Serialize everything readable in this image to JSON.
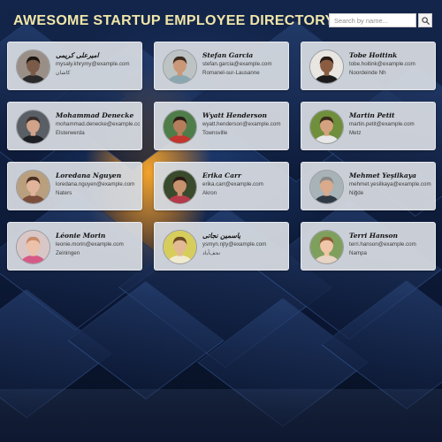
{
  "header": {
    "title": "AWESOME STARTUP EMPLOYEE DIRECTORY",
    "search": {
      "placeholder": "Search by name...",
      "value": ""
    },
    "search_button_icon": "search-icon"
  },
  "colors": {
    "title": "#f1e6a8",
    "card": "#d6dae0",
    "background": "#0e1d3c",
    "glow": "#ffa020"
  },
  "employees": [
    {
      "name": "امیرعلی کریمی",
      "email": "mysaly.khrymy@example.com",
      "city": "کاشان",
      "avatar": {
        "bg": "#9a8f86",
        "skin": "#7a5a48",
        "hair": "#1c1612",
        "shirt": "#2a2a2a"
      }
    },
    {
      "name": "Stefan Garcia",
      "email": "stefan.garcia@example.com",
      "city": "Romanel-sur-Lausanne",
      "avatar": {
        "bg": "#bcc3c2",
        "skin": "#c99878",
        "hair": "#3c2a1e",
        "shirt": "#8aa7b0"
      }
    },
    {
      "name": "Tobe Hoitink",
      "email": "tobe.hoitink@example.com",
      "city": "Noordeinde Nh",
      "avatar": {
        "bg": "#e9e6e2",
        "skin": "#8a5d42",
        "hair": "#2a1d16",
        "shirt": "#1b1b1b"
      }
    },
    {
      "name": "Mohammad Denecke",
      "email": "mohammad.denecke@example.com",
      "city": "Elsterwerda",
      "avatar": {
        "bg": "#5a5f66",
        "skin": "#d1a389",
        "hair": "#3a2f2a",
        "shirt": "#1d1f24"
      }
    },
    {
      "name": "Wyatt Henderson",
      "email": "wyatt.henderson@example.com",
      "city": "Townsville",
      "avatar": {
        "bg": "#4f7d4a",
        "skin": "#b57d5c",
        "hair": "#2b1e16",
        "shirt": "#c2362f"
      }
    },
    {
      "name": "Martin Petit",
      "email": "martin.petit@example.com",
      "city": "Metz",
      "avatar": {
        "bg": "#6f8f3c",
        "skin": "#d4a27e",
        "hair": "#3b2a1d",
        "shirt": "#e8e8e8"
      }
    },
    {
      "name": "Loredana Nguyen",
      "email": "loredana.nguyen@example.com",
      "city": "Naters",
      "avatar": {
        "bg": "#b99f7d",
        "skin": "#e0b49a",
        "hair": "#4a2f22",
        "shirt": "#7a4e3a"
      }
    },
    {
      "name": "Erika Carr",
      "email": "erika.carr@example.com",
      "city": "Akron",
      "avatar": {
        "bg": "#3a4a2c",
        "skin": "#c8926e",
        "hair": "#2a1a12",
        "shirt": "#b53a4a"
      }
    },
    {
      "name": "Mehmet Yeşilkaya",
      "email": "mehmet.yesilkaya@example.com",
      "city": "Niğde",
      "avatar": {
        "bg": "#a8b3b8",
        "skin": "#d9aa8b",
        "hair": "#8a8a8a",
        "shirt": "#2f3a44"
      }
    },
    {
      "name": "Léonie Morin",
      "email": "leonie.morin@example.com",
      "city": "Zeiningen",
      "avatar": {
        "bg": "#d9c6c6",
        "skin": "#ecc1a9",
        "hair": "#c68a6a",
        "shirt": "#d65a86"
      }
    },
    {
      "name": "یاسمین نجاتی",
      "email": "ysmyn.njty@example.com",
      "city": "نجف‌آباد",
      "avatar": {
        "bg": "#d6cd5c",
        "skin": "#e3b894",
        "hair": "#6a4a22",
        "shirt": "#f0ead0"
      }
    },
    {
      "name": "Terri Hanson",
      "email": "terri.hanson@example.com",
      "city": "Nampa",
      "avatar": {
        "bg": "#7fa05c",
        "skin": "#f0c5a8",
        "hair": "#8a5a32",
        "shirt": "#e8d4c4"
      }
    }
  ]
}
